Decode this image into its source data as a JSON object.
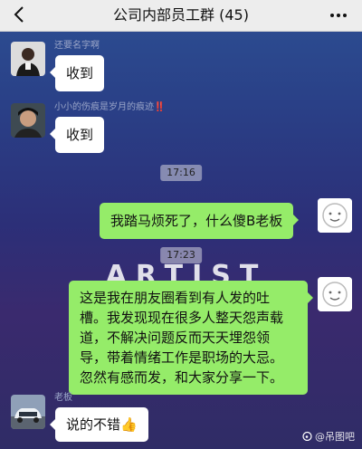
{
  "header": {
    "title": "公司内部员工群 (45)"
  },
  "messages": [
    {
      "sender": "还要名字啊",
      "text": "收到"
    },
    {
      "sender": "小小的伤痕是岁月的痕迹",
      "sender_emoji": "‼️",
      "text": "收到"
    },
    {
      "time": "17:16"
    },
    {
      "text": "我踏马烦死了，什么傻B老板"
    },
    {
      "time": "17:23"
    },
    {
      "text_lines": [
        "这是我在朋友圈看到有人发的吐",
        "槽。我发现现在很多人整天怨声载",
        "道，不解决问题反而天天埋怨领",
        "导，带着情绪工作是职场的大忌。",
        "忽然有感而发，和大家分享一下。"
      ]
    },
    {
      "sender": "老板",
      "text": "说的不错👍"
    }
  ],
  "watermark": "ARTIST",
  "site_mark": "吊图吧",
  "colors": {
    "self_bubble": "#95ec69",
    "other_bubble": "#ffffff",
    "header_bg": "#ededed"
  }
}
